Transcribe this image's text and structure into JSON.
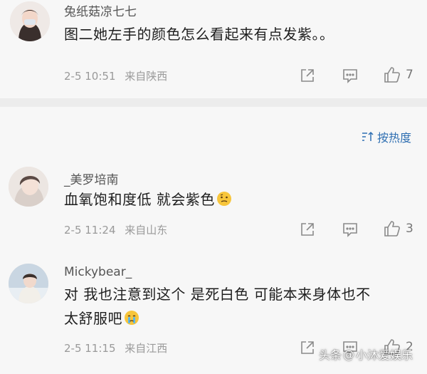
{
  "comments": [
    {
      "username": "兔纸菇凉七七",
      "text": "图二她左手的颜色怎么看起来有点发紫。。",
      "time": "2-5 10:51",
      "location": "来自陕西",
      "likes": "7"
    },
    {
      "username": "_美罗培南",
      "text": "血氧饱和度低 就会紫色",
      "time": "2-5 11:24",
      "location": "来自山东",
      "likes": "3"
    },
    {
      "username": "Mickybear_",
      "text_line1": "对 我也注意到这个 是死白色 可能本来身体也不",
      "text_line2": "太舒服吧",
      "time": "2-5 11:15",
      "location": "来自江西",
      "likes": "2"
    }
  ],
  "sort": {
    "label": "按热度"
  },
  "watermark": {
    "source": "头条",
    "account": "小沐爱娱乐"
  },
  "colors": {
    "accent": "#2f6fb2",
    "background": "#f7f7f7",
    "divider": "#ececec"
  }
}
